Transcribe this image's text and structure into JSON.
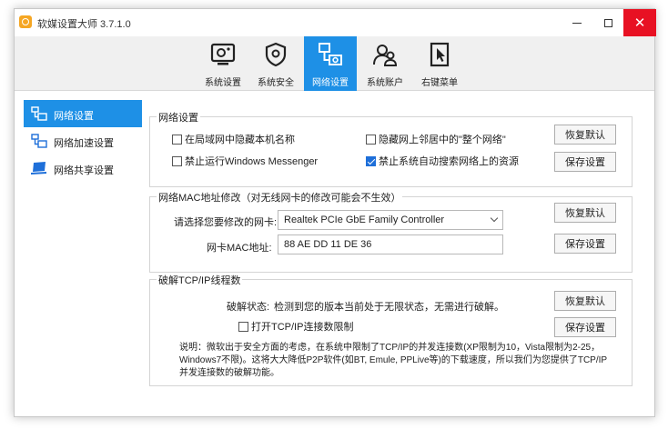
{
  "window": {
    "title": "软媒设置大师 3.7.1.0",
    "close_glyph": "✕"
  },
  "toolbar": {
    "tabs": [
      {
        "label": "系统设置",
        "icon": "system-settings-icon"
      },
      {
        "label": "系统安全",
        "icon": "shield-icon"
      },
      {
        "label": "网络设置",
        "icon": "network-icon",
        "active": true
      },
      {
        "label": "系统账户",
        "icon": "user-accounts-icon"
      },
      {
        "label": "右键菜单",
        "icon": "cursor-menu-icon"
      }
    ]
  },
  "sidebar": {
    "items": [
      {
        "label": "网络设置",
        "icon": "network-icon",
        "active": true
      },
      {
        "label": "网络加速设置",
        "icon": "network-accel-icon"
      },
      {
        "label": "网络共享设置",
        "icon": "laptop-share-icon"
      }
    ]
  },
  "network_settings": {
    "title": "网络设置",
    "options": [
      {
        "label": "在局域网中隐藏本机名称",
        "checked": false
      },
      {
        "label": "隐藏网上邻居中的\"整个网络\"",
        "checked": false
      },
      {
        "label": "禁止运行Windows Messenger",
        "checked": false
      },
      {
        "label": "禁止系统自动搜索网络上的资源",
        "checked": true
      }
    ],
    "restore_label": "恢复默认",
    "save_label": "保存设置"
  },
  "mac_settings": {
    "title": "网络MAC地址修改（对无线网卡的修改可能会不生效）",
    "adapter_label": "请选择您要修改的网卡:",
    "adapter_value": "Realtek PCIe GbE Family Controller",
    "mac_label": "网卡MAC地址:",
    "mac_value": "88 AE DD 11 DE 36",
    "restore_label": "恢复默认",
    "save_label": "保存设置"
  },
  "tcp_settings": {
    "title": "破解TCP/IP线程数",
    "status_label": "破解状态:",
    "status_value": "检测到您的版本当前处于无限状态，无需进行破解。",
    "enable_label": "打开TCP/IP连接数限制",
    "enable_checked": false,
    "restore_label": "恢复默认",
    "save_label": "保存设置",
    "note": "说明：微软出于安全方面的考虑，在系统中限制了TCP/IP的并发连接数(XP限制为10，Vista限制为2-25，Windows7不限)。这将大大降低P2P软件(如BT, Emule, PPLive等)的下载速度，所以我们为您提供了TCP/IP并发连接数的破解功能。"
  }
}
